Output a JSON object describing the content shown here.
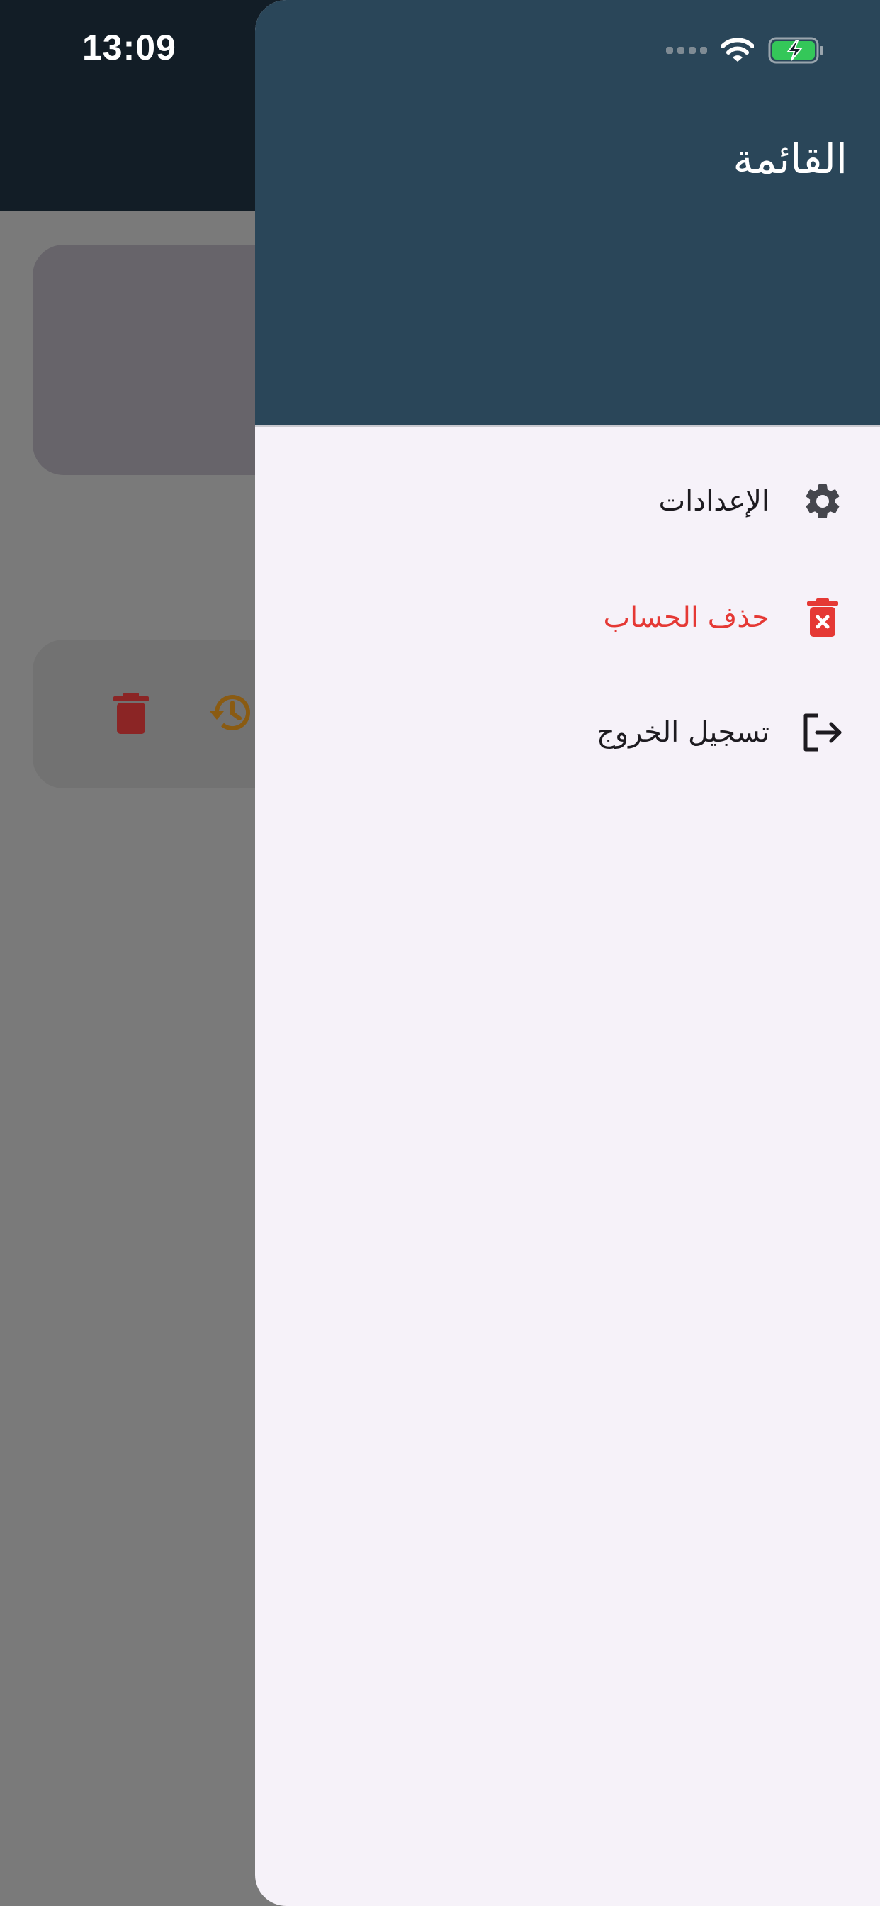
{
  "status_bar": {
    "time": "13:09",
    "icons": [
      "cellular-signal-icon",
      "wifi-icon",
      "battery-charging-icon"
    ]
  },
  "background": {
    "card_actions": [
      "delete-trash-icon",
      "history-restore-icon"
    ],
    "colors": {
      "trash": "#8b2525",
      "history": "#8a5b12"
    }
  },
  "drawer": {
    "title": "القائمة",
    "header_color": "#2a4659",
    "items": [
      {
        "label": "الإعدادات",
        "icon": "gear-icon"
      },
      {
        "label": "حذف الحساب",
        "icon": "trash-x-icon",
        "color": "#e53935"
      },
      {
        "label": "تسجيل الخروج",
        "icon": "logout-icon"
      }
    ]
  }
}
